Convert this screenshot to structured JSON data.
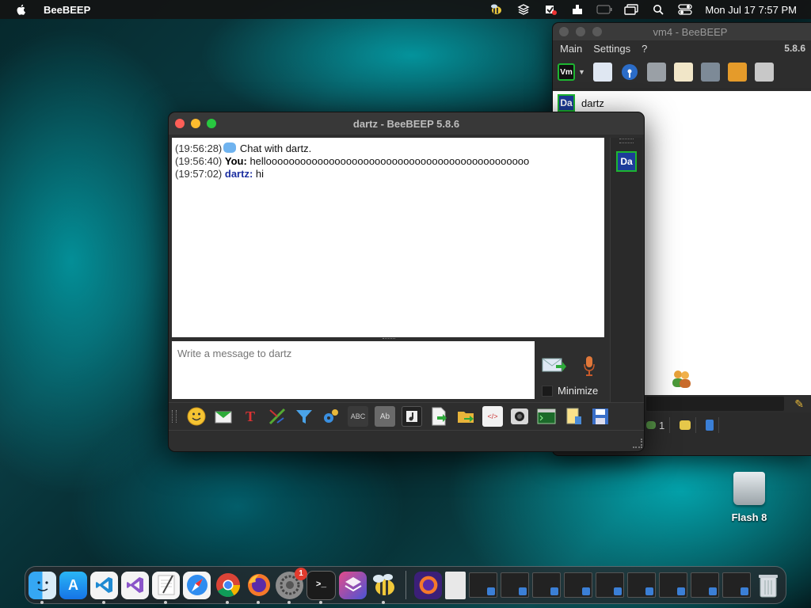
{
  "menubar": {
    "app_name": "BeeBEEP",
    "clock": "Mon Jul 17  7:57 PM",
    "status_icons": [
      "beebeep-menu-icon",
      "layers-icon",
      "vpn-icon",
      "upload-tray-icon",
      "battery-icon",
      "screen-mirroring-icon",
      "search-icon",
      "control-center-icon"
    ]
  },
  "main_window": {
    "title": "vm4 - BeeBEEP",
    "menu": [
      "Main",
      "Settings",
      "?"
    ],
    "version": "5.8.6",
    "profile_badge": "Vm",
    "user": {
      "avatar": "Da",
      "name": "dartz"
    },
    "bottom_count": "1"
  },
  "chat_window": {
    "title": "dartz - BeeBEEP 5.8.6",
    "messages": [
      {
        "time": "(19:56:28)",
        "sender": "",
        "text": "Chat with dartz."
      },
      {
        "time": "(19:56:40)",
        "sender": "You:",
        "text": "helloooooooooooooooooooooooooooooooooooooooooooooo"
      },
      {
        "time": "(19:57:02)",
        "sender": "dartz:",
        "text": "hi"
      }
    ],
    "input_placeholder": "Write a message to dartz",
    "minimize_label": "Minimize",
    "side_avatar": "Da",
    "toolbar_icons": [
      "emoticons-icon",
      "send-file-icon",
      "font-icon",
      "color-icon",
      "filter-icon",
      "settings-gear-icon",
      "spellcheck-icon",
      "word-completion-icon",
      "sound-icon",
      "save-chat-icon",
      "share-folder-icon",
      "html-code-icon",
      "screenshot-icon",
      "shell-icon",
      "notes-icon",
      "save-icon"
    ]
  },
  "desktop": {
    "icon_label": "Flash 8"
  },
  "dock": {
    "apps": [
      "finder-icon",
      "app-store-icon",
      "vscode-icon",
      "visual-studio-icon",
      "textedit-icon",
      "safari-icon",
      "chrome-icon",
      "firefox-icon",
      "system-settings-icon",
      "terminal-icon",
      "shortcuts-icon",
      "beebeep-icon"
    ],
    "settings_badge": "1"
  }
}
